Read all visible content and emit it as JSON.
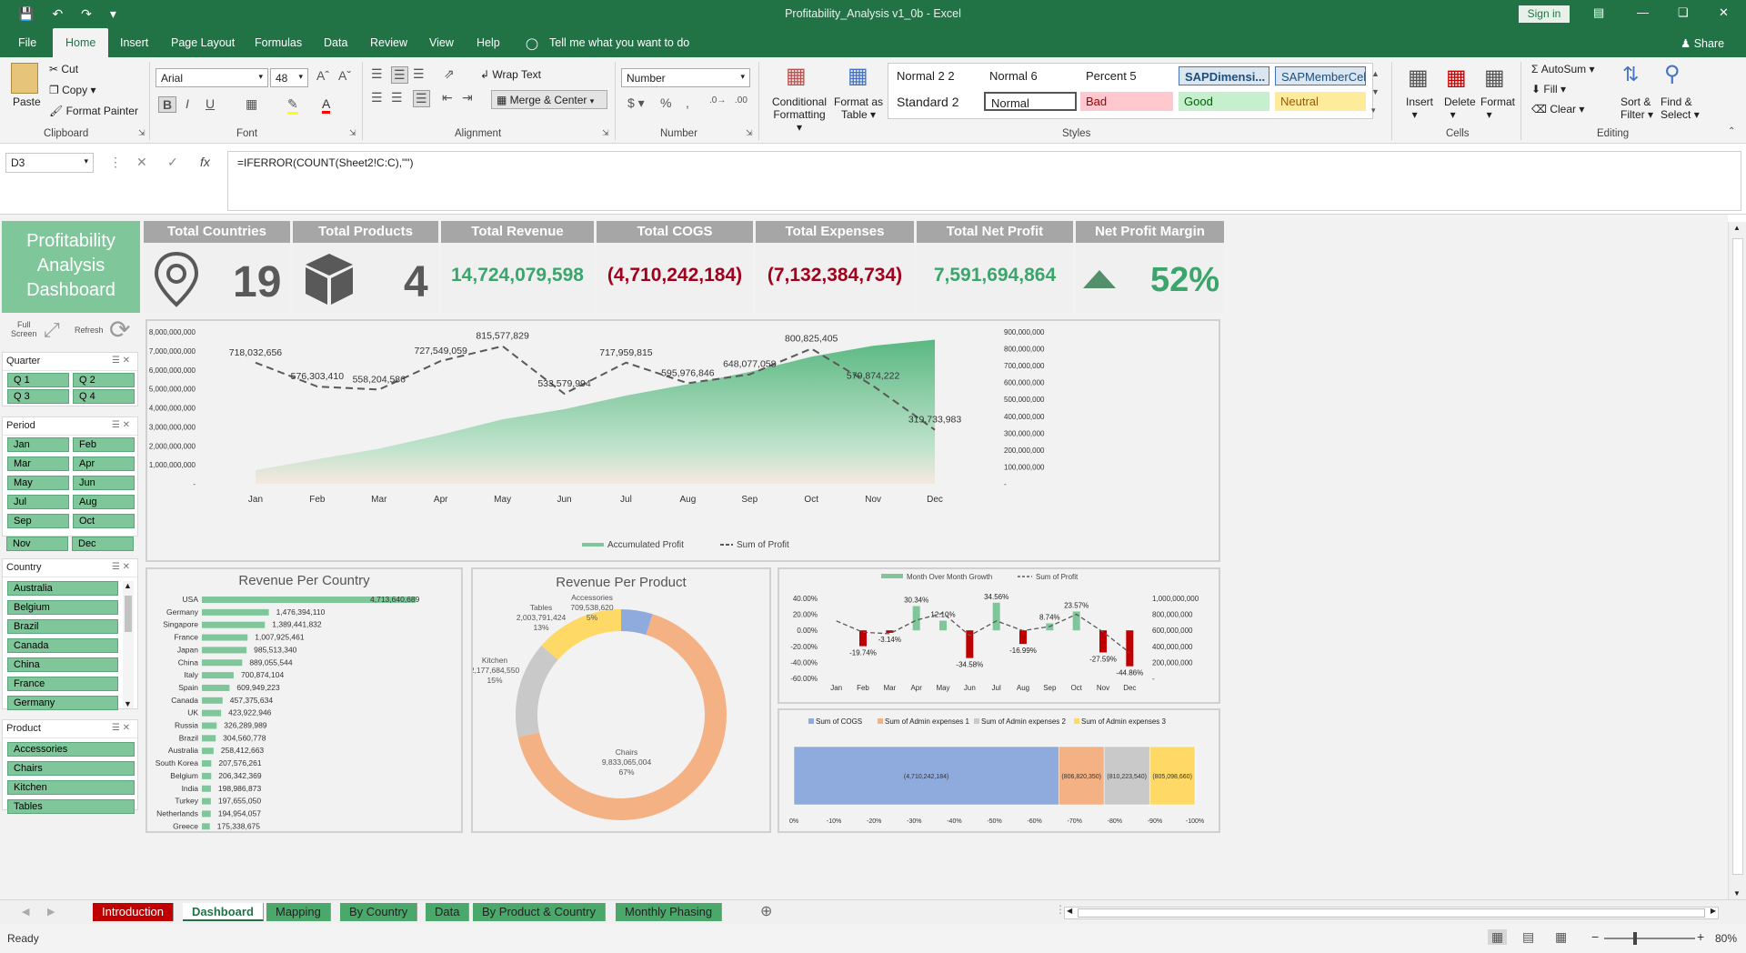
{
  "app": {
    "window_title": "Profitability_Analysis v1_0b  -  Excel",
    "signin": "Sign in",
    "share": "Share"
  },
  "menu": [
    "File",
    "Home",
    "Insert",
    "Page Layout",
    "Formulas",
    "Data",
    "Review",
    "View",
    "Help"
  ],
  "tell_me": "Tell me what you want to do",
  "ribbon": {
    "clipboard": {
      "paste": "Paste",
      "cut": "Cut",
      "copy": "Copy",
      "painter": "Format Painter",
      "label": "Clipboard"
    },
    "font": {
      "name": "Arial",
      "size": "48",
      "label": "Font"
    },
    "alignment": {
      "wrap": "Wrap Text",
      "merge": "Merge & Center",
      "label": "Alignment"
    },
    "number": {
      "format": "Number",
      "label": "Number"
    },
    "styles": {
      "cond": "Conditional",
      "cond2": "Formatting",
      "fmt_table": "Format as",
      "fmt_table2": "Table",
      "label": "Styles",
      "cells": [
        "Normal 2 2",
        "Normal 6",
        "Percent 5",
        "SAPDimensi...",
        "SAPMemberCell",
        "Standard 2",
        "Normal",
        "Bad",
        "Good",
        "Neutral"
      ]
    },
    "cells": {
      "insert": "Insert",
      "delete": "Delete",
      "format": "Format",
      "label": "Cells"
    },
    "editing": {
      "autosum": "AutoSum",
      "fill": "Fill",
      "clear": "Clear",
      "sort": "Sort &",
      "sort2": "Filter",
      "find": "Find &",
      "find2": "Select",
      "label": "Editing"
    }
  },
  "formula": {
    "cell": "D3",
    "text": "=IFERROR(COUNT(Sheet2!C:C),\"\")"
  },
  "dashboard": {
    "title": [
      "Profitability",
      "Analysis",
      "Dashboard"
    ],
    "kpis": [
      {
        "label": "Total Countries",
        "value": "19"
      },
      {
        "label": "Total Products",
        "value": "4"
      },
      {
        "label": "Total Revenue",
        "value": "14,724,079,598"
      },
      {
        "label": "Total COGS",
        "value": "(4,710,242,184)"
      },
      {
        "label": "Total Expenses",
        "value": "(7,132,384,734)"
      },
      {
        "label": "Total Net Profit",
        "value": "7,591,694,864"
      },
      {
        "label": "Net Profit Margin",
        "value": "52%"
      }
    ],
    "controls": {
      "full": "Full",
      "screen": "Screen",
      "refresh": "Refresh"
    },
    "slicers": {
      "quarter": {
        "title": "Quarter",
        "items": [
          "Q 1",
          "Q 2",
          "Q 3",
          "Q 4"
        ]
      },
      "period": {
        "title": "Period",
        "items": [
          "Jan",
          "Feb",
          "Mar",
          "Apr",
          "May",
          "Jun",
          "Jul",
          "Aug",
          "Sep",
          "Oct",
          "Nov",
          "Dec"
        ]
      },
      "country": {
        "title": "Country",
        "items": [
          "Australia",
          "Belgium",
          "Brazil",
          "Canada",
          "China",
          "France",
          "Germany"
        ]
      },
      "product": {
        "title": "Product",
        "items": [
          "Accessories",
          "Chairs",
          "Kitchen",
          "Tables"
        ]
      }
    }
  },
  "chart_data": [
    {
      "type": "area+line",
      "title": "",
      "categories": [
        "Jan",
        "Feb",
        "Mar",
        "Apr",
        "May",
        "Jun",
        "Jul",
        "Aug",
        "Sep",
        "Oct",
        "Nov",
        "Dec"
      ],
      "series": [
        {
          "name": "Accumulated Profit",
          "axis": "left",
          "values": [
            718032656,
            1294336066,
            1852540652,
            2580090711,
            3395668540,
            3929248534,
            4647208349,
            5243185195,
            5891262253,
            6692087658,
            7271962880,
            7591696863
          ]
        },
        {
          "name": "Sum of Profit",
          "axis": "right",
          "values": [
            718032656,
            576303410,
            558204586,
            727549059,
            815577829,
            533579994,
            717959815,
            595976846,
            648077058,
            800825405,
            579874222,
            319733983
          ]
        }
      ],
      "data_labels": [
        "718,032,656",
        "576,303,410",
        "558,204,586",
        "727,549,059",
        "815,577,829",
        "533,579,994",
        "717,959,815",
        "595,976,846",
        "648,077,058",
        "800,825,405",
        "579,874,222",
        "319,733,983"
      ],
      "y_left_ticks": [
        "8,000,000,000",
        "7,000,000,000",
        "6,000,000,000",
        "5,000,000,000",
        "4,000,000,000",
        "3,000,000,000",
        "2,000,000,000",
        "1,000,000,000",
        "-"
      ],
      "y_right_ticks": [
        "900,000,000",
        "800,000,000",
        "700,000,000",
        "600,000,000",
        "500,000,000",
        "400,000,000",
        "300,000,000",
        "200,000,000",
        "100,000,000",
        "-"
      ],
      "ylim_left": [
        0,
        8000000000
      ],
      "ylim_right": [
        0,
        900000000
      ],
      "legend": "bottom"
    },
    {
      "type": "bar",
      "title": "Revenue Per Country",
      "categories": [
        "USA",
        "Germany",
        "Singapore",
        "France",
        "Japan",
        "China",
        "Italy",
        "Spain",
        "Canada",
        "UK",
        "Russia",
        "Brazil",
        "Australia",
        "South Korea",
        "Belgium",
        "India",
        "Turkey",
        "Netherlands",
        "Greece"
      ],
      "values": [
        4713640689,
        1476394110,
        1389441832,
        1007925461,
        985513340,
        889055544,
        700874104,
        609949223,
        457375634,
        423922946,
        326289989,
        304560778,
        258412663,
        207576261,
        206342369,
        198986873,
        197655050,
        194954057,
        175338675
      ],
      "labels": [
        "4,713,640,689",
        "1,476,394,110",
        "1,389,441,832",
        "1,007,925,461",
        "985,513,340",
        "889,055,544",
        "700,874,104",
        "609,949,223",
        "457,375,634",
        "423,922,946",
        "326,289,989",
        "304,560,778",
        "258,412,663",
        "207,576,261",
        "206,342,369",
        "198,986,873",
        "197,655,050",
        "194,954,057",
        "175,338,675"
      ]
    },
    {
      "type": "pie",
      "title": "Revenue Per Product",
      "categories": [
        "Accessories",
        "Chairs",
        "Kitchen",
        "Tables"
      ],
      "values": [
        709538620,
        9833065004,
        2177684550,
        2003791424
      ],
      "labels": [
        "709,538,620",
        "9,833,065,004",
        "2,177,684,550",
        "2,003,791,424"
      ],
      "percents": [
        "5%",
        "67%",
        "15%",
        "13%"
      ],
      "colors": [
        "#8faadc",
        "#f4b183",
        "#c9c9c9",
        "#ffd966"
      ]
    },
    {
      "type": "bar+line",
      "title": "",
      "categories": [
        "Jan",
        "Feb",
        "Mar",
        "Apr",
        "May",
        "Jun",
        "Jul",
        "Aug",
        "Sep",
        "Oct",
        "Nov",
        "Dec"
      ],
      "series": [
        {
          "name": "Month Over Month Growth",
          "values": [
            0,
            -19.74,
            -3.14,
            30.34,
            12.1,
            -34.58,
            34.56,
            -16.99,
            8.74,
            23.57,
            -27.59,
            -44.86
          ]
        },
        {
          "name": "Sum of Profit",
          "values": [
            718032656,
            576303410,
            558204586,
            727549059,
            815577829,
            533579994,
            717959815,
            595976846,
            648077058,
            800825405,
            579874222,
            319733983
          ]
        }
      ],
      "growth_labels": [
        "",
        "-19.74%",
        "-3.14%",
        "30.34%",
        "12.10%",
        "-34.58%",
        "34.56%",
        "-16.99%",
        "8.74%",
        "23.57%",
        "-27.59%",
        "-44.86%"
      ],
      "y_left_ticks": [
        "40.00%",
        "20.00%",
        "0.00%",
        "-20.00%",
        "-40.00%",
        "-60.00%"
      ],
      "y_right_ticks": [
        "1,000,000,000",
        "800,000,000",
        "600,000,000",
        "400,000,000",
        "200,000,000",
        "-"
      ],
      "ylim_left": [
        -60,
        40
      ]
    },
    {
      "type": "stacked-bar",
      "title": "",
      "series": [
        {
          "name": "Sum of COGS",
          "value": -4710242184,
          "label": "(4,710,242,184)",
          "color": "#8faadc"
        },
        {
          "name": "Sum of Admin expenses 1",
          "value": -806820350,
          "label": "(806,820,350)",
          "color": "#f4b183"
        },
        {
          "name": "Sum of Admin expenses 2",
          "value": -810223540,
          "label": "(810,223,540)",
          "color": "#c9c9c9"
        },
        {
          "name": "Sum of Admin expenses 3",
          "value": -805098660,
          "label": "(805,098,660)",
          "color": "#ffd966"
        }
      ],
      "x_ticks": [
        "0%",
        "-10%",
        "-20%",
        "-30%",
        "-40%",
        "-50%",
        "-60%",
        "-70%",
        "-80%",
        "-90%",
        "-100%"
      ]
    }
  ],
  "sheet_tabs": [
    {
      "label": "Introduction",
      "color": "#c00000"
    },
    {
      "label": "Dashboard",
      "color": "#ffffff"
    },
    {
      "label": "Mapping",
      "color": "#4aa86a"
    },
    {
      "label": "By Country",
      "color": "#4aa86a"
    },
    {
      "label": "Data",
      "color": "#4aa86a"
    },
    {
      "label": "By Product & Country",
      "color": "#4aa86a"
    },
    {
      "label": "Monthly Phasing",
      "color": "#4aa86a"
    }
  ],
  "status": {
    "ready": "Ready",
    "zoom": "80%"
  }
}
